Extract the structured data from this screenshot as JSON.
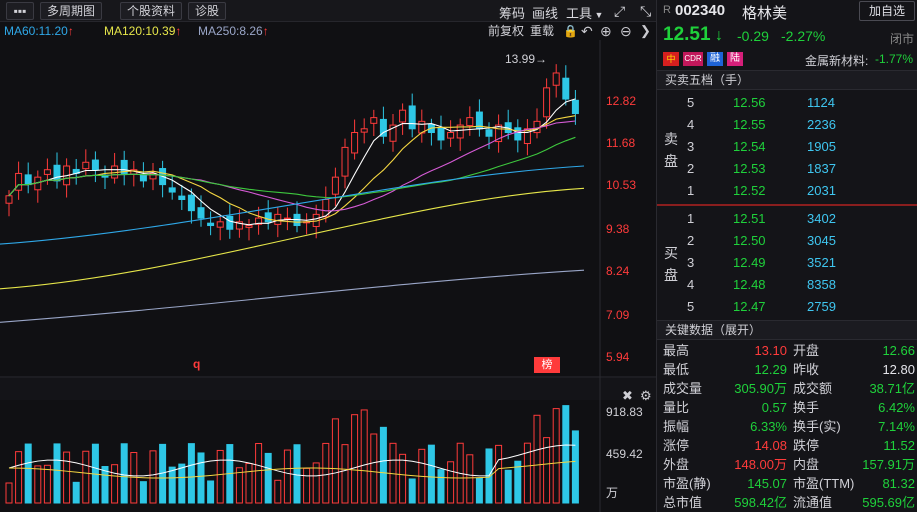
{
  "toolbar": {
    "menu_icon": "more-icon",
    "period_label": "多周期图",
    "profile_label": "个股资料",
    "diagnose_label": "诊股",
    "chips_label": "筹码",
    "draw_label": "画线",
    "tools_label": "工具",
    "fq_label": "前复权",
    "overlay_label": "重载"
  },
  "ma": {
    "ma60": "MA60:11.20",
    "ma120": "MA120:10.39",
    "ma250": "MA250:8.26",
    "colors": {
      "ma60": "#2fa8e8",
      "ma120": "#e6e64a",
      "ma250": "#9aa6c8"
    }
  },
  "chart_data": {
    "type": "candlestick",
    "price_axis": [
      "12.82",
      "11.68",
      "10.53",
      "9.38",
      "8.24",
      "7.09",
      "5.94"
    ],
    "high_marker": "13.99→",
    "marker_q": "q",
    "marker_bang": "榜",
    "volume_axis": [
      "918.83",
      "459.42",
      "万"
    ]
  },
  "stock": {
    "prefix": "R",
    "code": "002340",
    "name": "格林美",
    "add_label": "加自选",
    "price": "12.51",
    "change": "-0.29",
    "pct": "-2.27%",
    "status": "闭市",
    "badge_cn": "中",
    "badge_cdr": "CDR",
    "badge_rong": "融",
    "badge_lu": "陆",
    "sector": "金属新材料:",
    "sector_pct": "-1.77%"
  },
  "orderbook": {
    "title": "买卖五档（手）",
    "sell_label": "卖盘",
    "buy_label": "买盘",
    "sell": [
      {
        "lvl": "5",
        "price": "12.56",
        "vol": "1124"
      },
      {
        "lvl": "4",
        "price": "12.55",
        "vol": "2236"
      },
      {
        "lvl": "3",
        "price": "12.54",
        "vol": "1905"
      },
      {
        "lvl": "2",
        "price": "12.53",
        "vol": "1837"
      },
      {
        "lvl": "1",
        "price": "12.52",
        "vol": "2031"
      }
    ],
    "buy": [
      {
        "lvl": "1",
        "price": "12.51",
        "vol": "3402"
      },
      {
        "lvl": "2",
        "price": "12.50",
        "vol": "3045"
      },
      {
        "lvl": "3",
        "price": "12.49",
        "vol": "3521"
      },
      {
        "lvl": "4",
        "price": "12.48",
        "vol": "8358"
      },
      {
        "lvl": "5",
        "price": "12.47",
        "vol": "2759"
      }
    ]
  },
  "keydata": {
    "title": "关键数据（展开）",
    "rows": [
      {
        "l1": "最高",
        "v1": "13.10",
        "c1": "red",
        "l2": "开盘",
        "v2": "12.66",
        "c2": "green"
      },
      {
        "l1": "最低",
        "v1": "12.29",
        "c1": "green",
        "l2": "昨收",
        "v2": "12.80",
        "c2": "white"
      },
      {
        "l1": "成交量",
        "v1": "305.90万",
        "c1": "green",
        "l2": "成交额",
        "v2": "38.71亿",
        "c2": "green"
      },
      {
        "l1": "量比",
        "v1": "0.57",
        "c1": "green",
        "l2": "换手",
        "v2": "6.42%",
        "c2": "green"
      },
      {
        "l1": "振幅",
        "v1": "6.33%",
        "c1": "green",
        "l2": "换手(实)",
        "v2": "7.14%",
        "c2": "green"
      },
      {
        "l1": "涨停",
        "v1": "14.08",
        "c1": "red",
        "l2": "跌停",
        "v2": "11.52",
        "c2": "green"
      },
      {
        "l1": "外盘",
        "v1": "148.00万",
        "c1": "red",
        "l2": "内盘",
        "v2": "157.91万",
        "c2": "green"
      },
      {
        "l1": "市盈(静)",
        "v1": "145.07",
        "c1": "green",
        "l2": "市盈(TTM)",
        "v2": "81.32",
        "c2": "green"
      },
      {
        "l1": "总市值",
        "v1": "598.42亿",
        "c1": "green",
        "l2": "流通值",
        "v2": "595.69亿",
        "c2": "green"
      }
    ]
  }
}
